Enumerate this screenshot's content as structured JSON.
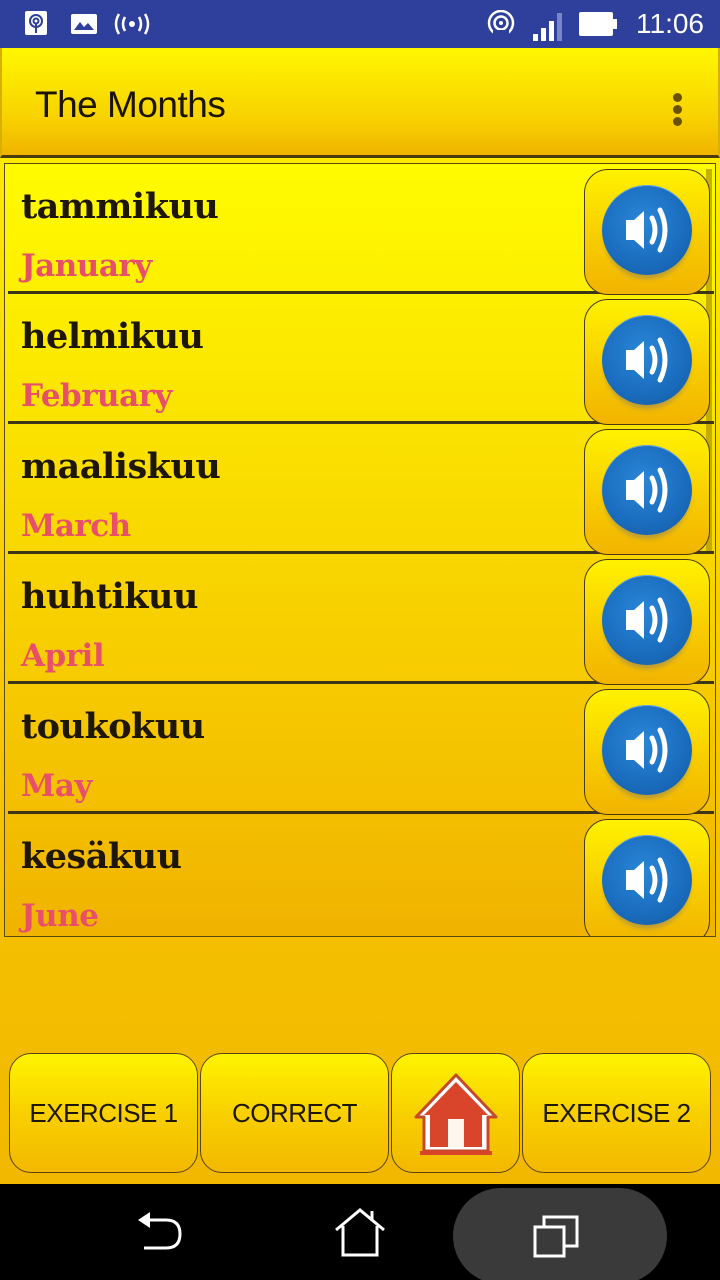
{
  "status_bar": {
    "left_icons": [
      "nfc-icon",
      "image-icon",
      "broadcast-icon"
    ],
    "right_icons": [
      "hotspot-icon",
      "signal-icon",
      "battery-icon"
    ],
    "time": "11:06"
  },
  "app_bar": {
    "title": "The Months",
    "overflow_icon": "more-vert-icon"
  },
  "list": {
    "items": [
      {
        "word": "tammikuu",
        "translation": "January",
        "icon": "speaker-icon"
      },
      {
        "word": "helmikuu",
        "translation": "February",
        "icon": "speaker-icon"
      },
      {
        "word": "maaliskuu",
        "translation": "March",
        "icon": "speaker-icon"
      },
      {
        "word": "huhtikuu",
        "translation": "April",
        "icon": "speaker-icon"
      },
      {
        "word": "toukokuu",
        "translation": "May",
        "icon": "speaker-icon"
      },
      {
        "word": "kesäkuu",
        "translation": "June",
        "icon": "speaker-icon"
      }
    ]
  },
  "bottom_bar": {
    "exercise1_label": "EXERCISE 1",
    "correct_label": "CORRECT",
    "home_icon": "home-icon",
    "exercise2_label": "EXERCISE 2"
  },
  "nav_bar": {
    "back_icon": "back-icon",
    "home_icon": "home-outline-icon",
    "recents_icon": "recents-icon"
  },
  "colors": {
    "status_bar": "#2e3f9c",
    "accent_yellow": "#fff200",
    "translation_pink": "#e8506a",
    "speaker_blue": "#1a6cbd",
    "home_red": "#d9452a"
  }
}
